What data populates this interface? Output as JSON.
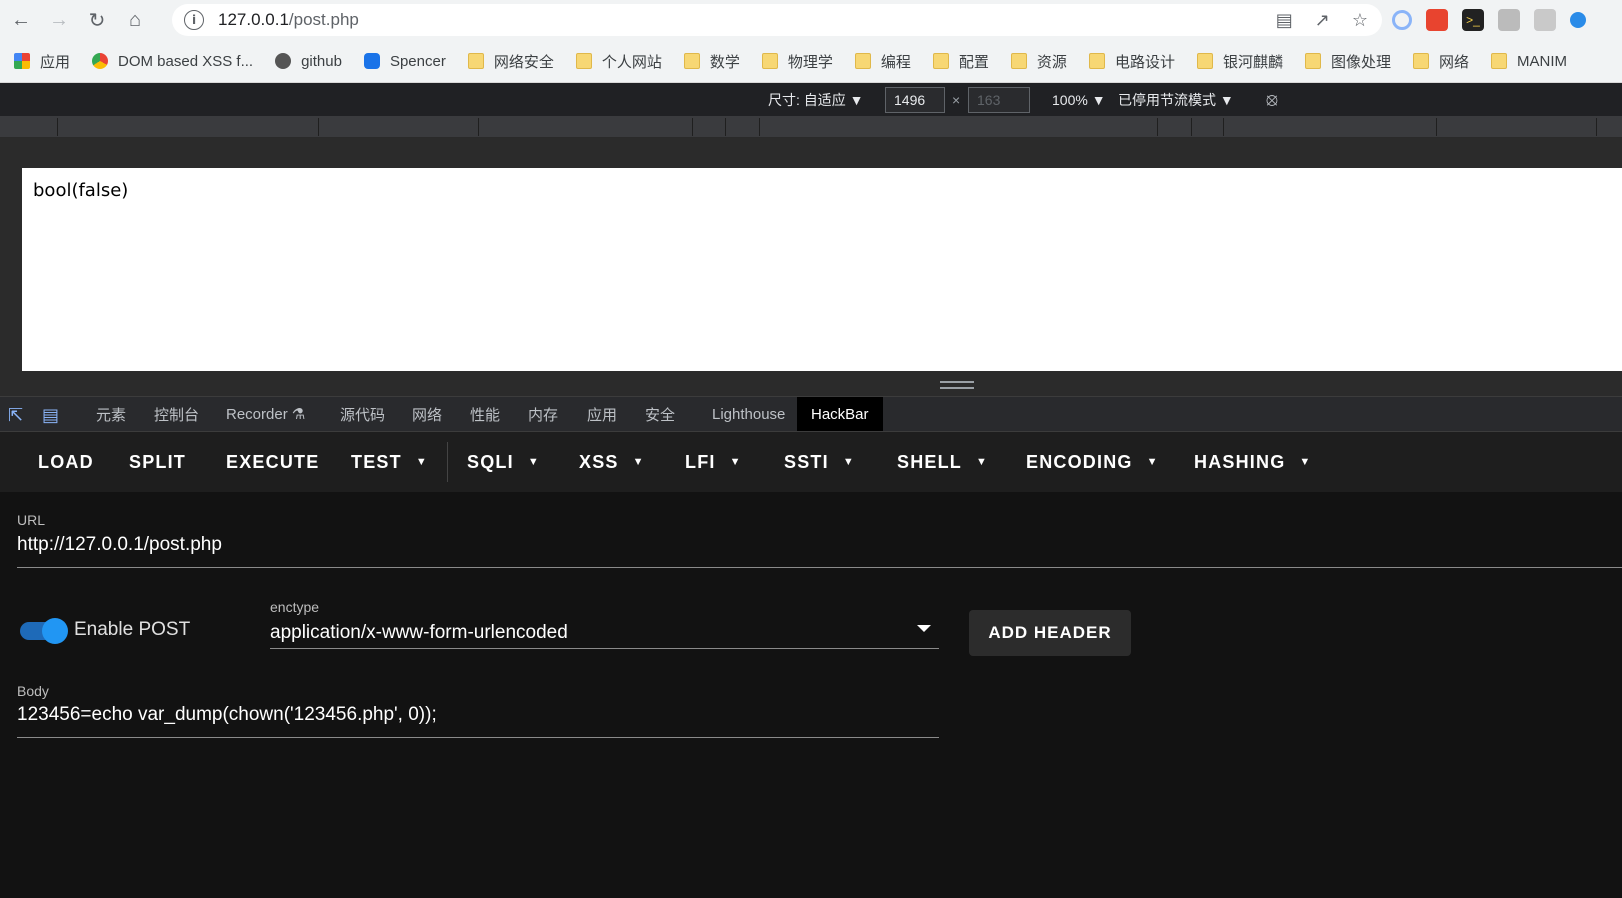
{
  "browser": {
    "url_host": "127.0.0.1",
    "url_path": "/post.php"
  },
  "bookmarks": [
    {
      "label": "应用",
      "icon": "apps-icon"
    },
    {
      "label": "DOM based XSS f...",
      "icon": "chrome-icon"
    },
    {
      "label": "github",
      "icon": "github-icon"
    },
    {
      "label": "Spencer",
      "icon": "hexagon-icon"
    },
    {
      "label": "网络安全",
      "icon": "folder-icon"
    },
    {
      "label": "个人网站",
      "icon": "folder-icon"
    },
    {
      "label": "数学",
      "icon": "folder-icon"
    },
    {
      "label": "物理学",
      "icon": "folder-icon"
    },
    {
      "label": "编程",
      "icon": "folder-icon"
    },
    {
      "label": "配置",
      "icon": "folder-icon"
    },
    {
      "label": "资源",
      "icon": "folder-icon"
    },
    {
      "label": "电路设计",
      "icon": "folder-icon"
    },
    {
      "label": "银河麒麟",
      "icon": "folder-icon"
    },
    {
      "label": "图像处理",
      "icon": "folder-icon"
    },
    {
      "label": "网络",
      "icon": "folder-icon"
    },
    {
      "label": "MANIM",
      "icon": "folder-icon"
    }
  ],
  "device_toolbar": {
    "dimensions_label": "尺寸: 自适应 ▼",
    "width": "1496",
    "times": "×",
    "height": "163",
    "zoom": "100% ▼",
    "throttle": "已停用节流模式 ▼"
  },
  "page_output": "bool(false)",
  "devtools_tabs": [
    "元素",
    "控制台",
    "Recorder",
    "源代码",
    "网络",
    "性能",
    "内存",
    "应用",
    "安全",
    "Lighthouse",
    "HackBar"
  ],
  "hackbar": {
    "toolbar": [
      {
        "label": "LOAD",
        "dropdown": false
      },
      {
        "label": "SPLIT",
        "dropdown": false
      },
      {
        "label": "EXECUTE",
        "dropdown": false
      },
      {
        "label": "TEST",
        "dropdown": true
      },
      {
        "label": "SQLI",
        "dropdown": true
      },
      {
        "label": "XSS",
        "dropdown": true
      },
      {
        "label": "LFI",
        "dropdown": true
      },
      {
        "label": "SSTI",
        "dropdown": true
      },
      {
        "label": "SHELL",
        "dropdown": true
      },
      {
        "label": "ENCODING",
        "dropdown": true
      },
      {
        "label": "HASHING",
        "dropdown": true
      }
    ],
    "url_label": "URL",
    "url_value": "http://127.0.0.1/post.php",
    "enable_post_label": "Enable POST",
    "enable_post": true,
    "enctype_label": "enctype",
    "enctype_value": "application/x-www-form-urlencoded",
    "add_header_label": "ADD HEADER",
    "body_label": "Body",
    "body_value": "123456=echo var_dump(chown('123456.php', 0));"
  },
  "colors": {
    "toggle_on": "#2196f3",
    "devtools_bg": "#121212"
  }
}
